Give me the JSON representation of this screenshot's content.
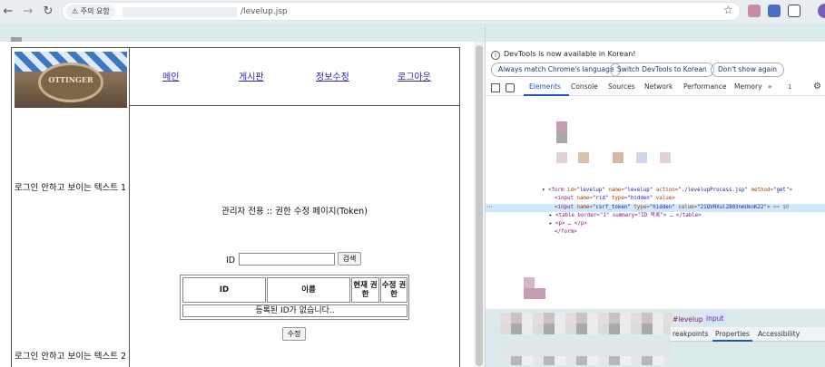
{
  "browser": {
    "security_chip": "⚠ 주의 요함",
    "url_path": "/levelup.jsp",
    "back_icon": "arrow-left-icon",
    "forward_icon": "arrow-right-icon",
    "reload_icon": "reload-icon"
  },
  "page": {
    "logo_text": "OTTINGER",
    "nav": [
      "메인",
      "게시판",
      "정보수정",
      "로그아웃"
    ],
    "side_text_1": "로그인 안하고 보이는 텍스트 1",
    "side_text_2": "로그인 안하고 보이는 텍스트 2",
    "heading": "관리자 전용 :: 권한 수정 페이지(Token)",
    "id_label": "ID",
    "id_input_value": "",
    "search_button": "검색",
    "table_headers": [
      "ID",
      "이름",
      "현재 권한",
      "수정 권한"
    ],
    "empty_message": "등록된 ID가 없습니다..",
    "edit_button": "수정"
  },
  "devtools": {
    "info_text": "DevTools is now available in Korean!",
    "pills": [
      "Always match Chrome's language",
      "Switch DevTools to Korean",
      "Don't show again"
    ],
    "tabs": [
      "Elements",
      "Console",
      "Sources",
      "Network",
      "Performance",
      "Memory"
    ],
    "more_tabs": "»",
    "issues_badge": "1",
    "code": {
      "form_tag": "form",
      "form_id": "levelup",
      "form_name": "levelup",
      "form_action": "./levelupProcess.jsp",
      "form_method": "get",
      "input1_name": "rid",
      "input1_type": "hidden",
      "input1_value": "value",
      "input2_name": "csrf_token",
      "input2_type": "hidden",
      "input2_value": "21QVHXul2803nmUknK22",
      "selected_marker": "== $0",
      "table_line": "<table border=\"1\" summary=\"ID 목록\"> … </table>",
      "p_line": "<p> … </p>",
      "form_close": "</form>"
    },
    "breadcrumbs": [
      "#levelup",
      "input"
    ],
    "subtabs": [
      "reakpoints",
      "Properties",
      "Accessibility"
    ]
  },
  "colors": {
    "link": "#2a2aa8",
    "accent": "#1a56c4",
    "selected": "#cfe8fc",
    "band": "#dbeaeb"
  }
}
